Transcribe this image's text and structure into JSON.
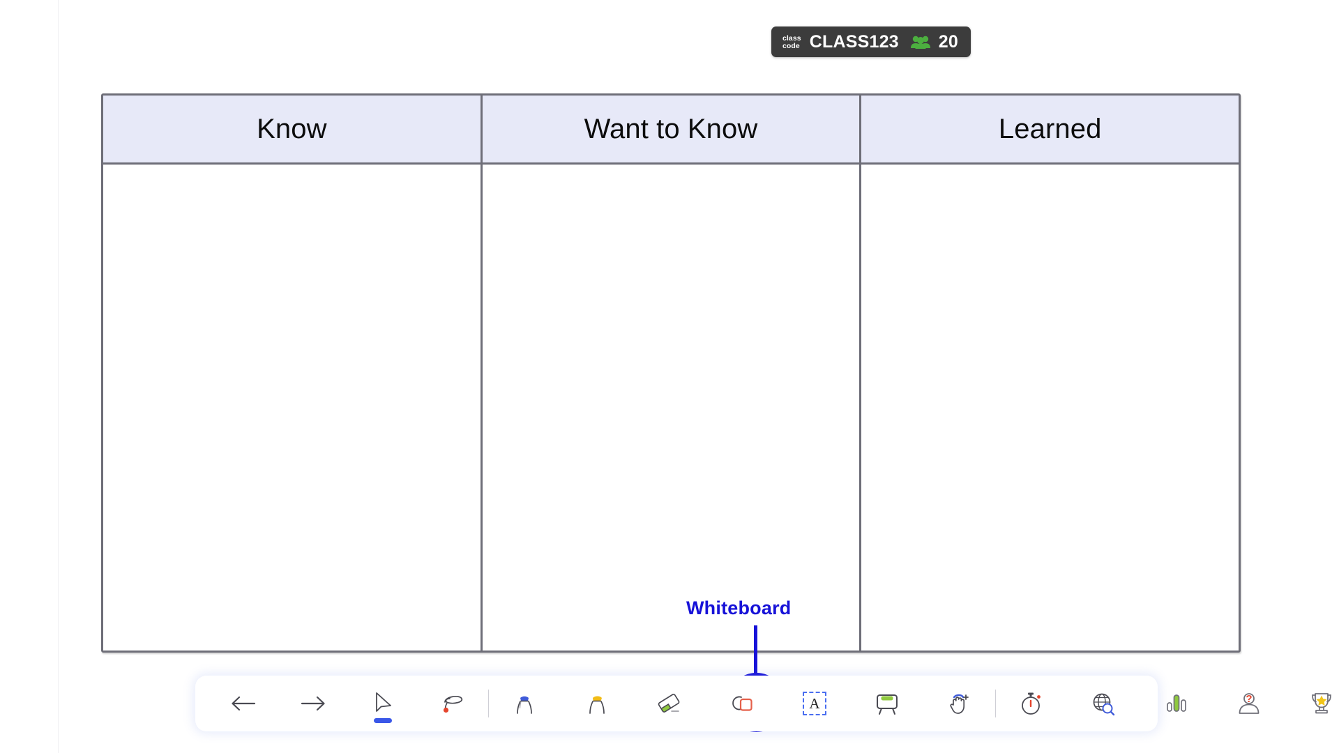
{
  "app": {
    "background_color": "#ffffff",
    "accent_color": "#3a57e8"
  },
  "class_badge": {
    "kicker_line1": "class",
    "kicker_line2": "code",
    "code": "CLASS123",
    "people_icon": "people-icon",
    "student_count": "20",
    "background_color": "#3c3c3c",
    "people_icon_color": "#4caf3f"
  },
  "kwl_chart": {
    "columns": [
      {
        "header": "Know",
        "content": ""
      },
      {
        "header": "Want to Know",
        "content": ""
      },
      {
        "header": "Learned",
        "content": ""
      }
    ],
    "header_background": "#e7e9f8",
    "border_color": "#6e6e78"
  },
  "annotation": {
    "label": "Whiteboard",
    "color": "#1712d8",
    "target": "whiteboard-tool"
  },
  "toolbar": {
    "items": [
      {
        "name": "undo-arrow-icon",
        "label": "Undo",
        "icon": "arrow-left",
        "active": false
      },
      {
        "name": "redo-arrow-icon",
        "label": "Redo",
        "icon": "arrow-right",
        "active": false
      },
      {
        "name": "select-cursor-icon",
        "label": "Select",
        "icon": "cursor",
        "active": true
      },
      {
        "name": "lasso-select-icon",
        "label": "Lasso Select",
        "icon": "lasso",
        "active": false
      },
      {
        "name": "pen-icon",
        "label": "Pen",
        "icon": "pen",
        "active": false
      },
      {
        "name": "highlighter-icon",
        "label": "Highlighter",
        "icon": "highlighter",
        "active": false
      },
      {
        "name": "eraser-icon",
        "label": "Eraser",
        "icon": "eraser",
        "active": false
      },
      {
        "name": "shapes-icon",
        "label": "Shapes",
        "icon": "shapes",
        "active": false
      },
      {
        "name": "text-tool-icon",
        "label": "Text",
        "icon": "text-a",
        "active": false
      },
      {
        "name": "whiteboard-tool",
        "label": "Whiteboard",
        "icon": "easel",
        "active": false
      },
      {
        "name": "hand-pan-icon",
        "label": "Pan",
        "icon": "hand",
        "active": false
      },
      {
        "name": "timer-icon",
        "label": "Timer",
        "icon": "stopwatch",
        "active": false
      },
      {
        "name": "web-search-icon",
        "label": "Web Search",
        "icon": "globe-search",
        "active": false
      },
      {
        "name": "poll-chart-icon",
        "label": "Poll",
        "icon": "bar-chart",
        "active": false
      },
      {
        "name": "random-student-icon",
        "label": "Random Student",
        "icon": "person-query",
        "active": false
      },
      {
        "name": "awards-trophy-icon",
        "label": "Awards",
        "icon": "trophy",
        "active": false
      }
    ]
  }
}
